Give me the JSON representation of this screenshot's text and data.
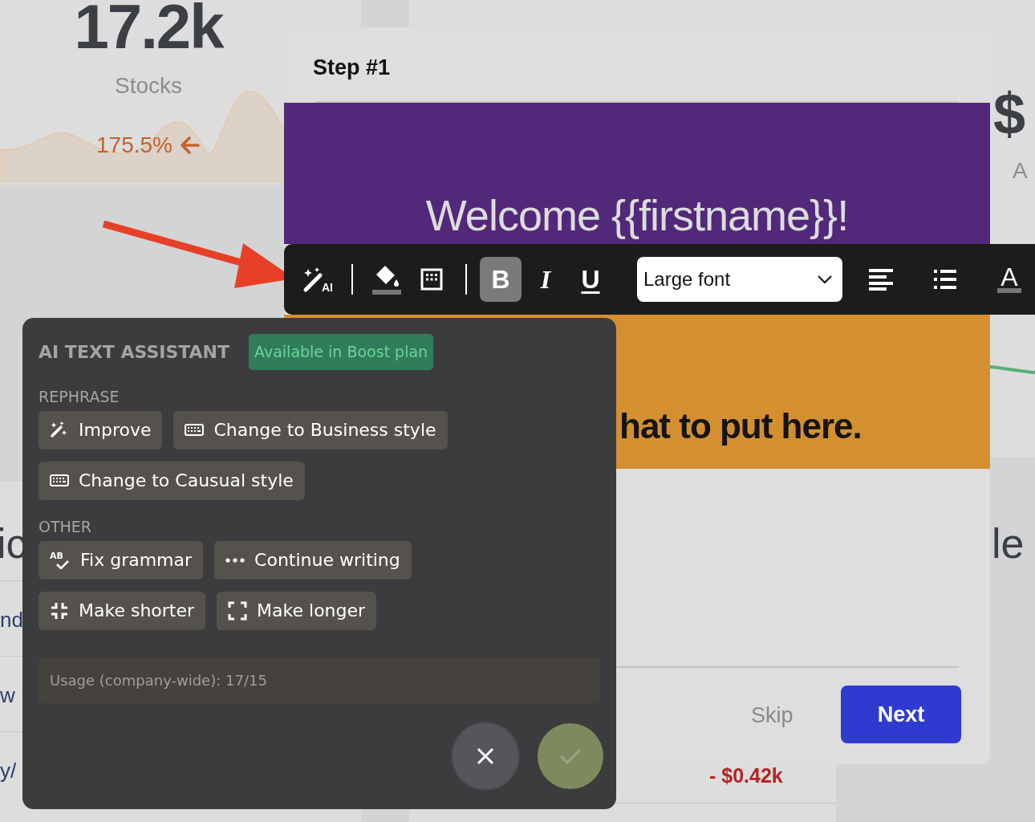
{
  "background": {
    "stat_card": {
      "value": "17.2k",
      "label": "Stocks",
      "change": "175.5%"
    },
    "right_card": {
      "value": "$",
      "label": "A"
    },
    "left_table": {
      "heading": "ic",
      "rows": [
        "nd",
        "w",
        "y/"
      ]
    },
    "right_table": {
      "heading": "le",
      "amount": "- $0.42k"
    }
  },
  "modal": {
    "title": "Step #1",
    "banner_text": "Welcome {{firstname}}!",
    "body_text": "hat to put here.",
    "buttons": [
      {
        "label": "Skip",
        "kind": "link"
      },
      {
        "label": "Next",
        "kind": "primary"
      }
    ]
  },
  "toolbar": {
    "tools": [
      {
        "kind": "ai",
        "label": "AI",
        "selected": false
      },
      {
        "kind": "separator"
      },
      {
        "kind": "fill",
        "selected": false
      },
      {
        "kind": "table",
        "selected": false
      },
      {
        "kind": "separator"
      },
      {
        "kind": "bold",
        "label": "B",
        "selected": true
      },
      {
        "kind": "italic",
        "label": "I",
        "selected": false
      },
      {
        "kind": "underline",
        "label": "U",
        "selected": false
      },
      {
        "kind": "select",
        "value": "Large font"
      },
      {
        "kind": "align",
        "selected": false
      },
      {
        "kind": "list",
        "selected": false
      },
      {
        "kind": "color",
        "label": "A",
        "selected": false
      }
    ]
  },
  "ai_panel": {
    "title": "AI TEXT ASSISTANT",
    "badge": "Available in Boost plan",
    "sections": [
      {
        "label": "REPHRASE",
        "rows": [
          [
            {
              "label": "Improve",
              "kind": "wand"
            },
            {
              "label": "Change to Business style",
              "kind": "keyboard"
            }
          ],
          [
            {
              "label": "Change to Causual style",
              "kind": "keyboard"
            }
          ]
        ]
      },
      {
        "label": "OTHER",
        "rows": [
          [
            {
              "label": "Fix grammar",
              "kind": "spellcheck",
              "icon_text": "AB"
            },
            {
              "label": "Continue writing",
              "kind": "dots"
            }
          ],
          [
            {
              "label": "Make shorter",
              "kind": "shrink"
            },
            {
              "label": "Make longer",
              "kind": "expand"
            }
          ]
        ]
      }
    ],
    "usage": "Usage (company-wide): 17/15",
    "confirm_disabled": true
  }
}
